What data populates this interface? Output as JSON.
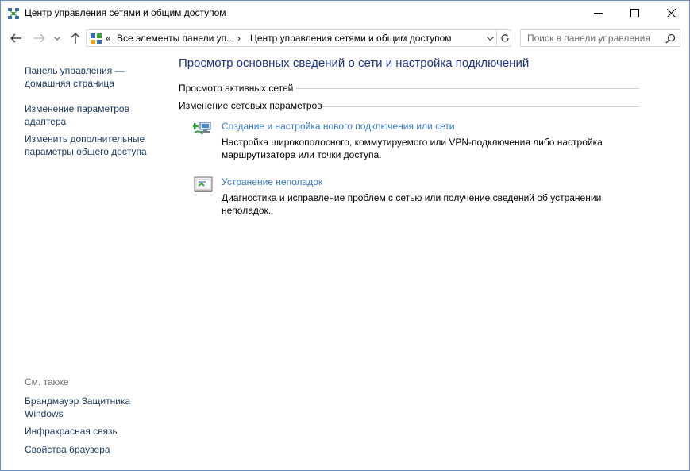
{
  "window": {
    "title": "Центр управления сетями и общим доступом",
    "minimize_label": "",
    "maximize_label": "",
    "close_label": ""
  },
  "address_bar": {
    "overflow_chevron": "«",
    "crumbs": [
      "Все элементы панели уп...",
      "Центр управления сетями и общим доступом"
    ],
    "separator": "›"
  },
  "search": {
    "placeholder": "Поиск в панели управления"
  },
  "sidebar": {
    "items": [
      {
        "label": "Панель управления — домашняя страница"
      },
      {
        "label": "Изменение параметров адаптера"
      },
      {
        "label": "Изменить дополнительные параметры общего доступа"
      }
    ],
    "see_also_title": "См. также",
    "see_also": [
      {
        "label": "Брандмауэр Защитника Windows"
      },
      {
        "label": "Инфракрасная связь"
      },
      {
        "label": "Свойства браузера"
      }
    ]
  },
  "main": {
    "title": "Просмотр основных сведений о сети и настройка подключений",
    "active_networks_heading": "Просмотр активных сетей",
    "change_settings_heading": "Изменение сетевых параметров",
    "tasks": [
      {
        "link": "Создание и настройка нового подключения или сети",
        "description": "Настройка широкополосного, коммутируемого или VPN-подключения либо настройка маршрутизатора или точки доступа.",
        "icon": "new-connection-icon"
      },
      {
        "link": "Устранение неполадок",
        "description": "Диагностика и исправление проблем с сетью или получение сведений об устранении неполадок.",
        "icon": "troubleshoot-icon"
      }
    ]
  },
  "colors": {
    "link": "#3c78c8",
    "title": "#1e3287",
    "sidebar_link": "#1e395b",
    "muted": "#6d6d6d",
    "window_border": "#6b8fb8"
  }
}
